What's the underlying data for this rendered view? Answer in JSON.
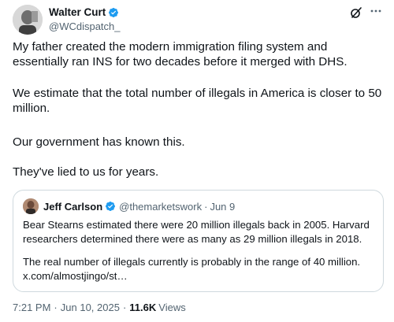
{
  "author": {
    "name": "Walter Curt",
    "handle": "@WCdispatch_"
  },
  "tweet": {
    "paragraphs": [
      "My father created the modern immigration filing system and essentially ran INS for two decades before it merged with DHS.",
      "We estimate that the total number of illegals in America is closer to 50 million.",
      "Our government has known this.",
      "They've lied to us for years."
    ]
  },
  "quote": {
    "name": "Jeff Carlson",
    "handle": "@themarketswork",
    "date": "Jun 9",
    "paragraphs": [
      "Bear Stearns estimated there were 20 million illegals back in 2005. Harvard researchers determined there were as many as 29 million illegals in 2018.",
      "The real number of illegals currently is probably in the range of 40 million. x.com/almostjingo/st…"
    ]
  },
  "meta": {
    "time": "7:21 PM",
    "date": "Jun 10, 2025",
    "views_count": "11.6K",
    "views_label": "Views"
  },
  "icons": {
    "verified": "verified-badge-icon",
    "grok": "grok-icon",
    "more": "more-icon"
  },
  "colors": {
    "text": "#0f1419",
    "secondary": "#536471",
    "verified": "#1d9bf0",
    "border": "#cfd9de"
  }
}
